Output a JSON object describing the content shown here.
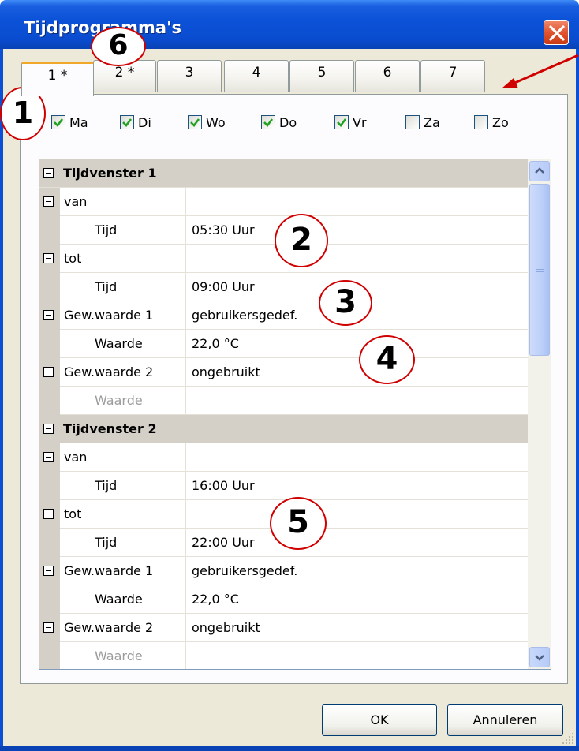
{
  "window": {
    "title": "Tijdprogramma's"
  },
  "tabs": [
    {
      "label": "1 *",
      "active": true
    },
    {
      "label": "2 *",
      "active": false
    },
    {
      "label": "3",
      "active": false
    },
    {
      "label": "4",
      "active": false
    },
    {
      "label": "5",
      "active": false
    },
    {
      "label": "6",
      "active": false
    },
    {
      "label": "7",
      "active": false
    }
  ],
  "days": [
    {
      "label": "Ma",
      "checked": true
    },
    {
      "label": "Di",
      "checked": true
    },
    {
      "label": "Wo",
      "checked": true
    },
    {
      "label": "Do",
      "checked": true
    },
    {
      "label": "Vr",
      "checked": true
    },
    {
      "label": "Za",
      "checked": false
    },
    {
      "label": "Zo",
      "checked": false
    }
  ],
  "grid": {
    "rows": [
      {
        "type": "header",
        "label": "Tijdvenster 1"
      },
      {
        "type": "group",
        "label": "van",
        "value": ""
      },
      {
        "type": "sub",
        "label": "Tijd",
        "value": "05:30 Uur"
      },
      {
        "type": "group",
        "label": "tot",
        "value": ""
      },
      {
        "type": "sub",
        "label": "Tijd",
        "value": "09:00 Uur"
      },
      {
        "type": "group",
        "label": "Gew.waarde 1",
        "value": "gebruikersgedef."
      },
      {
        "type": "sub",
        "label": "Waarde",
        "value": "22,0 °C"
      },
      {
        "type": "group",
        "label": "Gew.waarde 2",
        "value": "ongebruikt"
      },
      {
        "type": "sub-disabled",
        "label": "Waarde",
        "value": ""
      },
      {
        "type": "header",
        "label": "Tijdvenster 2"
      },
      {
        "type": "group",
        "label": "van",
        "value": ""
      },
      {
        "type": "sub",
        "label": "Tijd",
        "value": "16:00 Uur"
      },
      {
        "type": "group",
        "label": "tot",
        "value": ""
      },
      {
        "type": "sub",
        "label": "Tijd",
        "value": "22:00 Uur"
      },
      {
        "type": "group",
        "label": "Gew.waarde 1",
        "value": "gebruikersgedef."
      },
      {
        "type": "sub",
        "label": "Waarde",
        "value": "22,0 °C"
      },
      {
        "type": "group",
        "label": "Gew.waarde 2",
        "value": "ongebruikt"
      },
      {
        "type": "sub-disabled",
        "label": "Waarde",
        "value": ""
      }
    ]
  },
  "buttons": {
    "ok": "OK",
    "cancel": "Annuleren"
  },
  "callouts": [
    "1",
    "2",
    "3",
    "4",
    "5",
    "6"
  ],
  "colors": {
    "titlebar": "#0a4fd6",
    "callout_border": "#d00000",
    "checkmark": "#21a121",
    "active_tab_accent": "#f1a72a"
  }
}
